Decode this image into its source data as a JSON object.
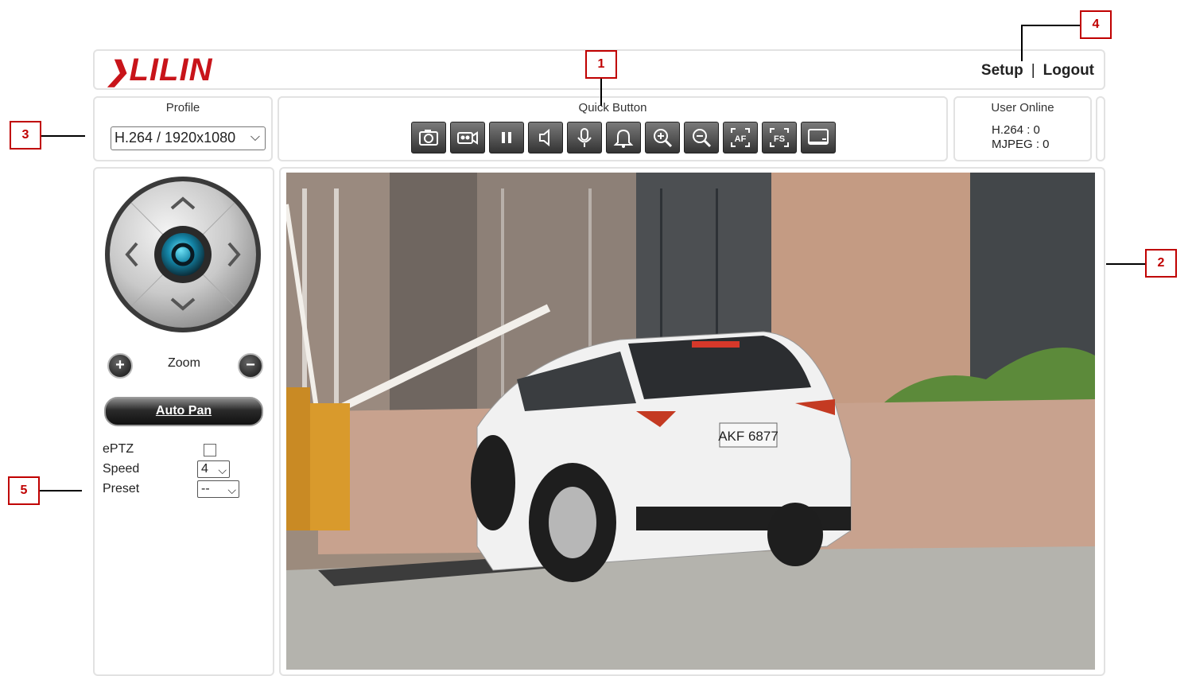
{
  "header": {
    "logo_text": "LILIN",
    "setup_label": "Setup",
    "separator": "|",
    "logout_label": "Logout"
  },
  "profile": {
    "title": "Profile",
    "selected": "H.264 / 1920x1080"
  },
  "quick_button": {
    "title": "Quick Button",
    "buttons": [
      "snapshot-icon",
      "record-icon",
      "pause-icon",
      "speaker-icon",
      "microphone-icon",
      "bell-icon",
      "zoom-in-icon",
      "zoom-out-icon",
      "AF",
      "FS",
      "display-icon"
    ]
  },
  "user_online": {
    "title": "User Online",
    "h264": "H.264 : 0",
    "mjpeg": "MJPEG : 0"
  },
  "ptz": {
    "zoom_label": "Zoom",
    "zoom_in": "+",
    "zoom_out": "−",
    "autopan_label": "Auto Pan",
    "eptz_label": "ePTZ",
    "speed_label": "Speed",
    "speed_value": "4",
    "preset_label": "Preset",
    "preset_value": "--"
  },
  "video": {
    "plate": "AKF 6877"
  },
  "callouts": {
    "c1": "1",
    "c2": "2",
    "c3": "3",
    "c4": "4",
    "c5": "5"
  },
  "colors": {
    "brand_red": "#c8141a",
    "callout_red": "#c00000"
  }
}
